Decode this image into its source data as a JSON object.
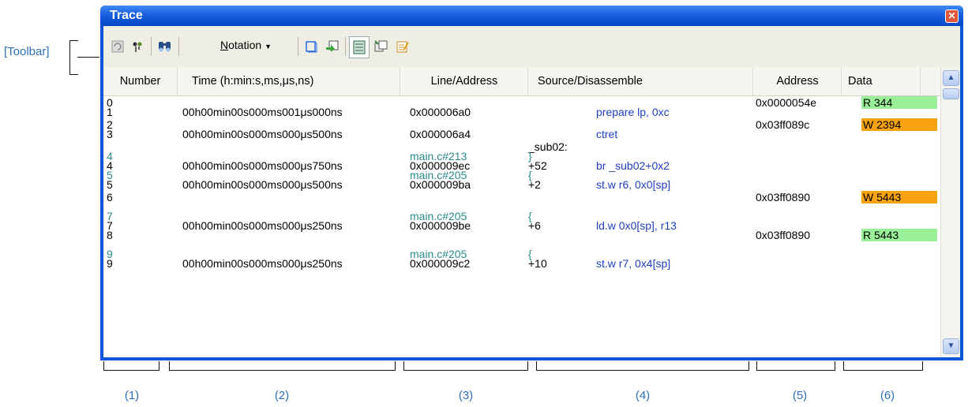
{
  "callouts": {
    "toolbar": "[Toolbar]",
    "columns": [
      "(1)",
      "(2)",
      "(3)",
      "(4)",
      "(5)",
      "(6)"
    ]
  },
  "window": {
    "title": "Trace",
    "close_icon": "close-icon"
  },
  "toolbar": {
    "notation_label": "Notation",
    "notation_accel": "N",
    "notation_rest": "otation",
    "icons": [
      "refresh-icon",
      "trace-stop-icon",
      "find-icon",
      "notation-dropdown",
      "select-range-icon",
      "restore-icon",
      "mix-display-icon",
      "copy-icon",
      "edit-icon"
    ]
  },
  "columns": {
    "number": "Number",
    "time": "Time (h:min:s,ms,μs,ns)",
    "line_address": "Line/Address",
    "source": "Source/Disassemble",
    "address": "Address",
    "data": "Data"
  },
  "colors": {
    "read_chip": "#99f099",
    "write_chip": "#f7a30f",
    "source_teal": "#2a8a8a",
    "mnemonic_blue": "#1f3fbf"
  },
  "rows": [
    {
      "num": "0",
      "time": "",
      "line": "",
      "off": "",
      "src": "",
      "src_kind": "",
      "address": "0x0000054e",
      "data": "R 344",
      "data_kind": "read"
    },
    {
      "num": "1",
      "time": "00h00min00s000ms001μs000ns",
      "line": "0x000006a0",
      "off": "",
      "src": "prepare   lp, 0xc",
      "src_kind": "asm",
      "address": "",
      "data": "",
      "data_kind": ""
    },
    {
      "num": "2",
      "time": "",
      "line": "",
      "off": "",
      "src": "",
      "src_kind": "",
      "address": "0x03ff089c",
      "data": "W 2394",
      "data_kind": "write"
    },
    {
      "num": "3",
      "time": "00h00min00s000ms000μs500ns",
      "line": "0x000006a4",
      "off": "",
      "src": "ctret",
      "src_kind": "asm",
      "address": "",
      "data": "",
      "data_kind": ""
    },
    {
      "num": "",
      "time": "",
      "line": "",
      "off": "_sub02:",
      "src": "",
      "src_kind": "",
      "address": "",
      "data": "",
      "data_kind": ""
    },
    {
      "num": "4",
      "time": "",
      "line": "main.c#213",
      "off": "}",
      "src": "",
      "src_kind": "source",
      "address": "",
      "data": "",
      "data_kind": ""
    },
    {
      "num": "4",
      "time": "00h00min00s000ms000μs750ns",
      "line": "0x000009ec",
      "off": "+52",
      "src": "br   _sub02+0x2",
      "src_kind": "asm",
      "address": "",
      "data": "",
      "data_kind": ""
    },
    {
      "num": "5",
      "time": "",
      "line": "main.c#205",
      "off": "{",
      "src": "",
      "src_kind": "source",
      "address": "",
      "data": "",
      "data_kind": ""
    },
    {
      "num": "5",
      "time": "00h00min00s000ms000μs500ns",
      "line": "0x000009ba",
      "off": "+2",
      "src": "st.w   r6, 0x0[sp]",
      "src_kind": "asm",
      "address": "",
      "data": "",
      "data_kind": ""
    },
    {
      "num": "6",
      "time": "",
      "line": "",
      "off": "",
      "src": "",
      "src_kind": "",
      "address": "0x03ff0890",
      "data": "W 5443",
      "data_kind": "write"
    },
    {
      "num": "",
      "time": "",
      "line": "",
      "off": "",
      "src": "",
      "src_kind": "",
      "address": "",
      "data": "",
      "data_kind": ""
    },
    {
      "num": "7",
      "time": "",
      "line": "main.c#205",
      "off": "{",
      "src": "",
      "src_kind": "source",
      "address": "",
      "data": "",
      "data_kind": ""
    },
    {
      "num": "7",
      "time": "00h00min00s000ms000μs250ns",
      "line": "0x000009be",
      "off": "+6",
      "src": "ld.w   0x0[sp], r13",
      "src_kind": "asm",
      "address": "",
      "data": "",
      "data_kind": ""
    },
    {
      "num": "8",
      "time": "",
      "line": "",
      "off": "",
      "src": "",
      "src_kind": "",
      "address": "0x03ff0890",
      "data": "R 5443",
      "data_kind": "read"
    },
    {
      "num": "",
      "time": "",
      "line": "",
      "off": "",
      "src": "",
      "src_kind": "",
      "address": "",
      "data": "",
      "data_kind": ""
    },
    {
      "num": "9",
      "time": "",
      "line": "main.c#205",
      "off": "{",
      "src": "",
      "src_kind": "source",
      "address": "",
      "data": "",
      "data_kind": ""
    },
    {
      "num": "9",
      "time": "00h00min00s000ms000μs250ns",
      "line": "0x000009c2",
      "off": "+10",
      "src": "st.w   r7, 0x4[sp]",
      "src_kind": "asm",
      "address": "",
      "data": "",
      "data_kind": ""
    }
  ]
}
